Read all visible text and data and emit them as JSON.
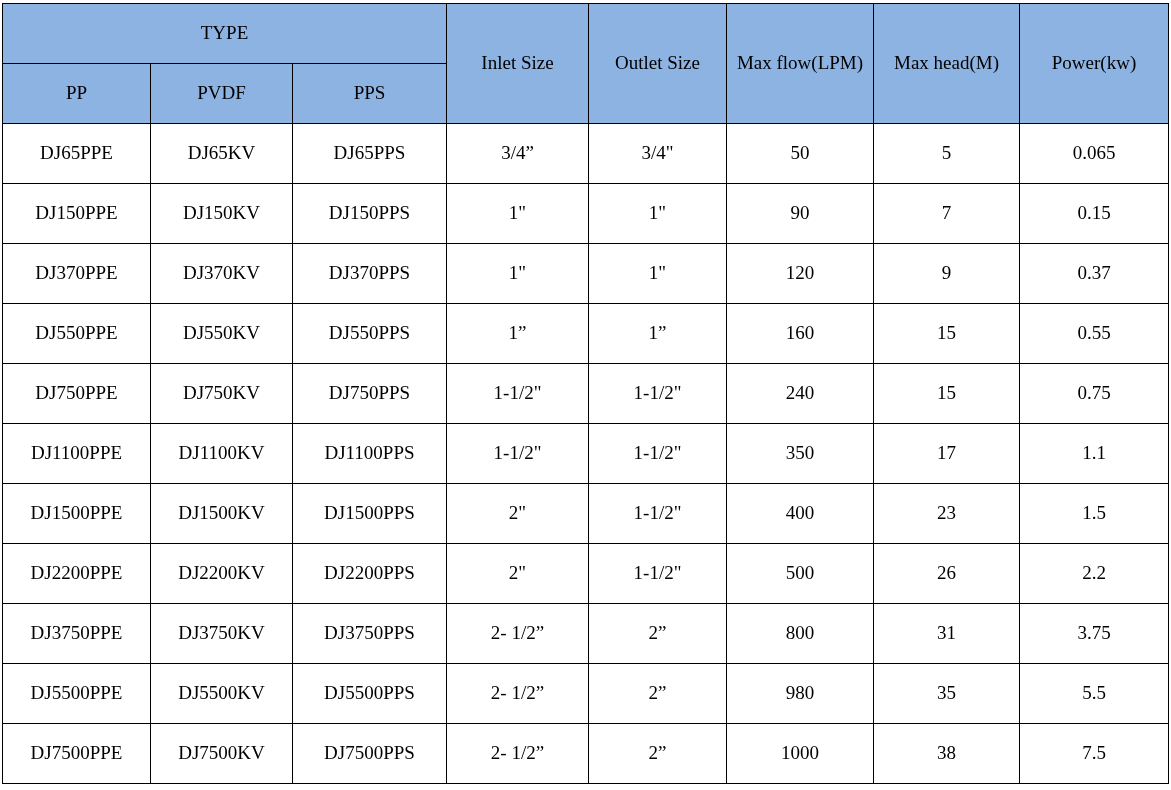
{
  "table": {
    "column_group": "TYPE",
    "columns": [
      {
        "label": "PP",
        "kind": "grouped"
      },
      {
        "label": "PVDF",
        "kind": "grouped"
      },
      {
        "label": "PPS",
        "kind": "grouped"
      },
      {
        "label": "Inlet Size",
        "kind": "single"
      },
      {
        "label": "Outlet Size",
        "kind": "single"
      },
      {
        "label": "Max flow(LPM)",
        "kind": "single"
      },
      {
        "label": "Max head(M)",
        "kind": "single"
      },
      {
        "label": "Power(kw)",
        "kind": "single"
      }
    ],
    "rows": [
      [
        "DJ65PPE",
        "DJ65KV",
        "DJ65PPS",
        "3/4”",
        "3/4\"",
        "50",
        "5",
        "0.065"
      ],
      [
        "DJ150PPE",
        "DJ150KV",
        "DJ150PPS",
        "1\"",
        "1\"",
        "90",
        "7",
        "0.15"
      ],
      [
        "DJ370PPE",
        "DJ370KV",
        "DJ370PPS",
        "1\"",
        "1\"",
        "120",
        "9",
        "0.37"
      ],
      [
        "DJ550PPE",
        "DJ550KV",
        "DJ550PPS",
        "1”",
        "1”",
        "160",
        "15",
        "0.55"
      ],
      [
        "DJ750PPE",
        "DJ750KV",
        "DJ750PPS",
        "1-1/2\"",
        "1-1/2\"",
        "240",
        "15",
        "0.75"
      ],
      [
        "DJ1100PPE",
        "DJ1100KV",
        "DJ1100PPS",
        "1-1/2\"",
        "1-1/2\"",
        "350",
        "17",
        "1.1"
      ],
      [
        "DJ1500PPE",
        "DJ1500KV",
        "DJ1500PPS",
        "2\"",
        "1-1/2\"",
        "400",
        "23",
        "1.5"
      ],
      [
        "DJ2200PPE",
        "DJ2200KV",
        "DJ2200PPS",
        "2\"",
        "1-1/2\"",
        "500",
        "26",
        "2.2"
      ],
      [
        "DJ3750PPE",
        "DJ3750KV",
        "DJ3750PPS",
        "2- 1/2”",
        "2”",
        "800",
        "31",
        "3.75"
      ],
      [
        "DJ5500PPE",
        "DJ5500KV",
        "DJ5500PPS",
        "2- 1/2”",
        "2”",
        "980",
        "35",
        "5.5"
      ],
      [
        "DJ7500PPE",
        "DJ7500KV",
        "DJ7500PPS",
        "2- 1/2”",
        "2”",
        "1000",
        "38",
        "7.5"
      ]
    ]
  }
}
